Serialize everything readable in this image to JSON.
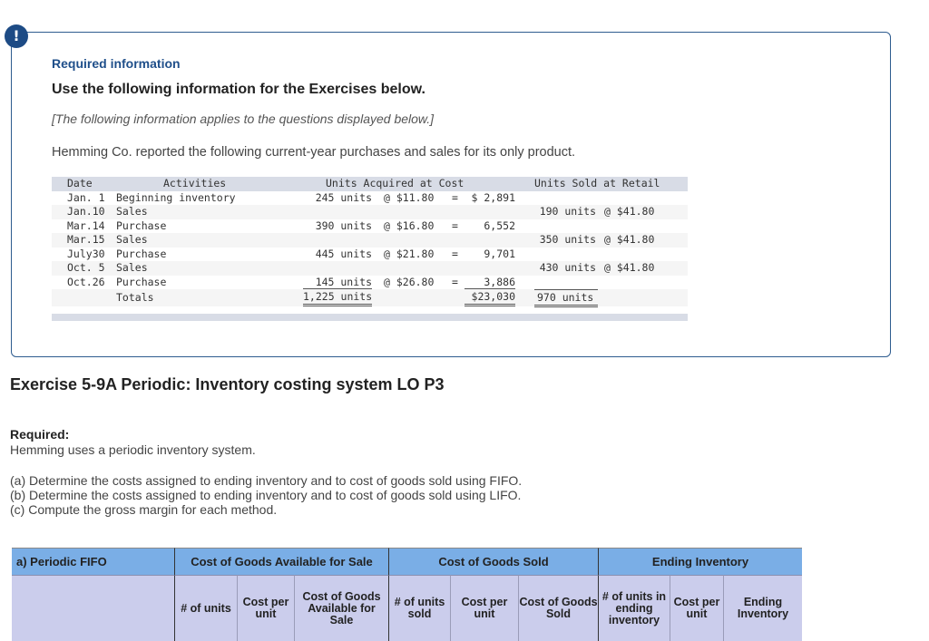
{
  "info": {
    "alert_icon": "!",
    "required_info": "Required information",
    "use_following": "Use the following information for the Exercises below.",
    "applies": "[The following information applies to the questions displayed below.]",
    "reported": "Hemming Co. reported the following current-year purchases and sales for its only product."
  },
  "data_table": {
    "headers": {
      "date": "Date",
      "activities": "Activities",
      "acquired": "Units Acquired at Cost",
      "sold": "Units Sold at Retail"
    },
    "rows": [
      {
        "date": "Jan. 1",
        "activity": "Beginning inventory",
        "acq_units": "245 units",
        "acq_at": "@ $11.80",
        "acq_eq": "=",
        "acq_total": "$ 2,891",
        "sold_units": "",
        "sold_at": ""
      },
      {
        "date": "Jan.10",
        "activity": "Sales",
        "acq_units": "",
        "acq_at": "",
        "acq_eq": "",
        "acq_total": "",
        "sold_units": "190 units",
        "sold_at": "@ $41.80"
      },
      {
        "date": "Mar.14",
        "activity": "Purchase",
        "acq_units": "390 units",
        "acq_at": "@ $16.80",
        "acq_eq": "=",
        "acq_total": "6,552",
        "sold_units": "",
        "sold_at": ""
      },
      {
        "date": "Mar.15",
        "activity": "Sales",
        "acq_units": "",
        "acq_at": "",
        "acq_eq": "",
        "acq_total": "",
        "sold_units": "350 units",
        "sold_at": "@ $41.80"
      },
      {
        "date": "July30",
        "activity": "Purchase",
        "acq_units": "445 units",
        "acq_at": "@ $21.80",
        "acq_eq": "=",
        "acq_total": "9,701",
        "sold_units": "",
        "sold_at": ""
      },
      {
        "date": "Oct. 5",
        "activity": "Sales",
        "acq_units": "",
        "acq_at": "",
        "acq_eq": "",
        "acq_total": "",
        "sold_units": "430 units",
        "sold_at": "@ $41.80"
      },
      {
        "date": "Oct.26",
        "activity": "Purchase",
        "acq_units": "145 units",
        "acq_at": "@ $26.80",
        "acq_eq": "=",
        "acq_total": "3,886",
        "sold_units": "",
        "sold_at": ""
      }
    ],
    "totals": {
      "label": "Totals",
      "acq_units": "1,225 units",
      "acq_total": "$23,030",
      "sold_units": "970 units"
    }
  },
  "exercise": {
    "title": "Exercise 5-9A Periodic: Inventory costing system LO P3",
    "required_label": "Required:",
    "required_text": "Hemming uses a periodic inventory system.",
    "tasks": [
      "(a) Determine the costs assigned to ending inventory and to cost of goods sold using FIFO.",
      "(b) Determine the costs assigned to ending inventory and to cost of goods sold using LIFO.",
      "(c) Compute the gross margin for each method."
    ]
  },
  "answer_table": {
    "title": "a) Periodic FIFO",
    "groups": [
      "Cost of Goods Available for Sale",
      "Cost of Goods Sold",
      "Ending Inventory"
    ],
    "columns": [
      "# of units",
      "Cost per unit",
      "Cost of Goods Available for Sale",
      "# of units sold",
      "Cost per unit",
      "Cost of Goods Sold",
      "# of units in ending inventory",
      "Cost per unit",
      "Ending Inventory"
    ]
  }
}
